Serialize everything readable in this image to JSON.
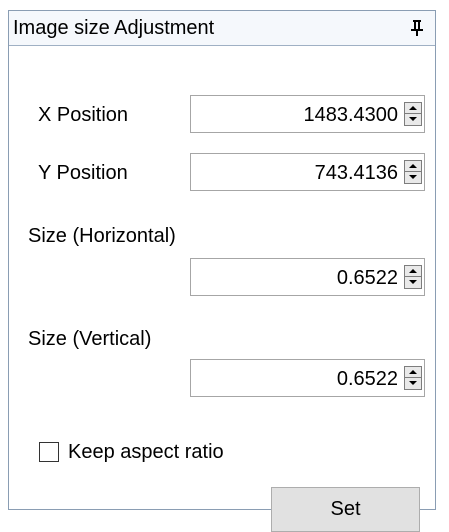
{
  "panel": {
    "title": "Image size Adjustment",
    "pin_icon": "pin-icon"
  },
  "fields": {
    "x_position": {
      "label": "X Position",
      "value": "1483.4300"
    },
    "y_position": {
      "label": "Y Position",
      "value": "743.4136"
    },
    "size_horizontal": {
      "label": "Size (Horizontal)",
      "value": "0.6522"
    },
    "size_vertical": {
      "label": "Size (Vertical)",
      "value": "0.6522"
    }
  },
  "keep_aspect_ratio": {
    "label": "Keep aspect ratio",
    "checked": false
  },
  "set_button": {
    "label": "Set"
  },
  "icons": {
    "spin_up": "chevron-up-icon",
    "spin_down": "chevron-down-icon"
  }
}
